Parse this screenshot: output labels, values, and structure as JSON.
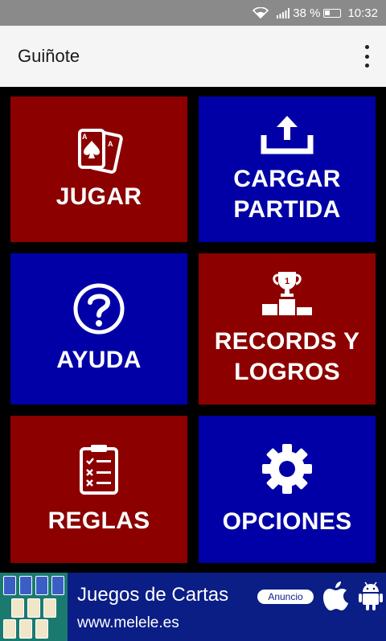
{
  "status_bar": {
    "battery": "38 %",
    "time": "10:32"
  },
  "app_bar": {
    "title": "Guiñote",
    "menu_icon": "more-vert-icon"
  },
  "tiles": [
    {
      "label": "JUGAR",
      "icon": "cards-icon",
      "color": "#8c0000"
    },
    {
      "label": "CARGAR PARTIDA",
      "icon": "upload-icon",
      "color": "#0000a6"
    },
    {
      "label": "AYUDA",
      "icon": "help-circle-icon",
      "color": "#0000a6"
    },
    {
      "label": "RECORDS Y LOGROS",
      "icon": "trophy-podium-icon",
      "color": "#8c0000"
    },
    {
      "label": "REGLAS",
      "icon": "clipboard-checklist-icon",
      "color": "#8c0000"
    },
    {
      "label": "OPCIONES",
      "icon": "gear-icon",
      "color": "#0000a6"
    }
  ],
  "ad": {
    "title": "Juegos de Cartas",
    "url": "www.melele.es",
    "badge": "Anuncio",
    "icons": [
      "apple-icon",
      "android-icon"
    ]
  }
}
